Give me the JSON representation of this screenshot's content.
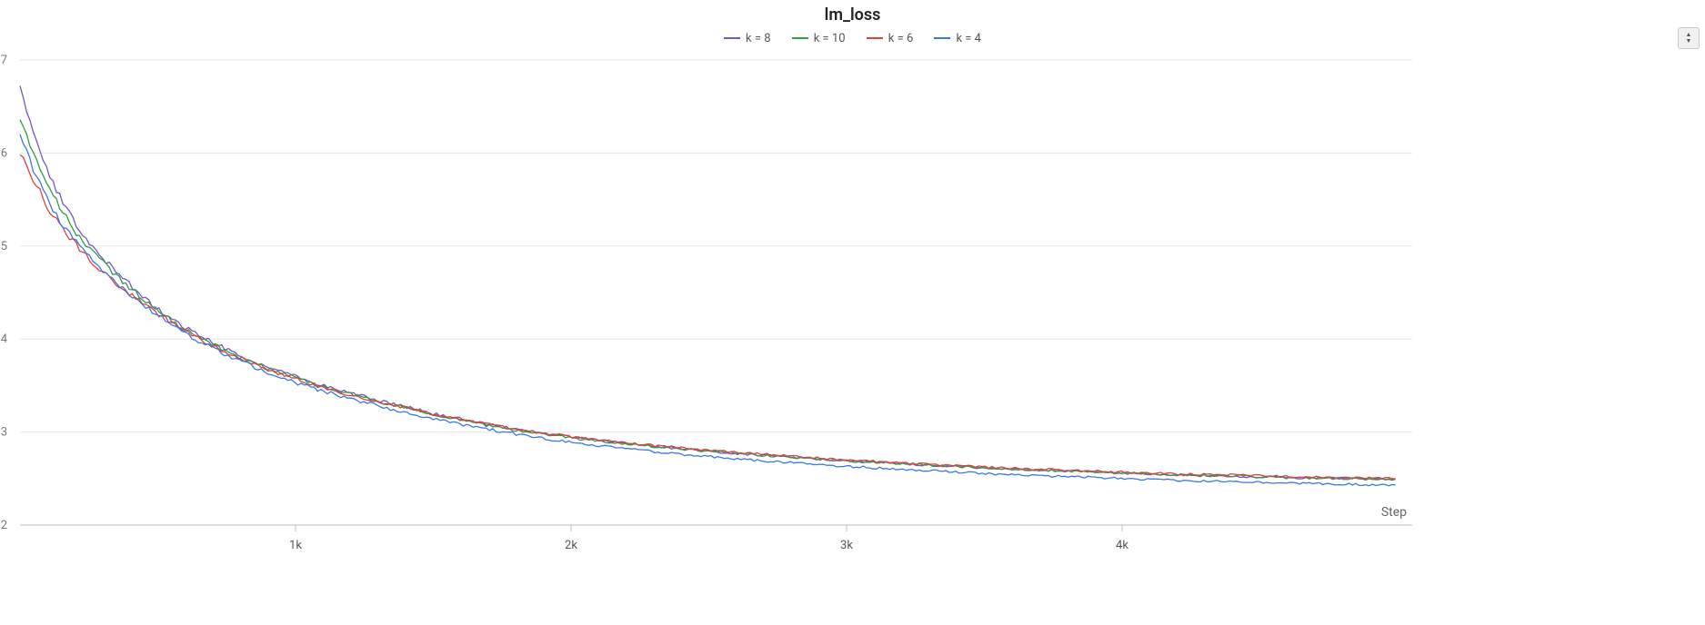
{
  "title": "lm_loss",
  "xlabel": "Step",
  "legend": [
    {
      "name": "k = 8",
      "color": "#7955c7"
    },
    {
      "name": "k = 10",
      "color": "#2e9e48"
    },
    {
      "name": "k = 6",
      "color": "#e2403c"
    },
    {
      "name": "k = 4",
      "color": "#3a78e6"
    }
  ],
  "y_ticks": [
    2,
    3,
    4,
    5,
    6,
    7
  ],
  "x_ticks": [
    {
      "v": 1000,
      "label": "1k"
    },
    {
      "v": 2000,
      "label": "2k"
    },
    {
      "v": 3000,
      "label": "3k"
    },
    {
      "v": 4000,
      "label": "4k"
    }
  ],
  "chart_data": {
    "type": "line",
    "xlabel": "Step",
    "ylabel": "lm_loss",
    "ylim": [
      2,
      7
    ],
    "xlim": [
      0,
      5000
    ],
    "series": [
      {
        "name": "k = 8",
        "color": "#7955c7",
        "x": [
          0,
          50,
          100,
          150,
          200,
          250,
          300,
          350,
          400,
          450,
          500,
          600,
          700,
          800,
          900,
          1000,
          1100,
          1200,
          1300,
          1400,
          1500,
          1600,
          1700,
          1800,
          1900,
          2000,
          2200,
          2400,
          2600,
          2800,
          3000,
          3200,
          3400,
          3600,
          3800,
          4000,
          4200,
          4400,
          4600,
          4800,
          5000
        ],
        "y": [
          6.7,
          6.2,
          5.8,
          5.5,
          5.25,
          5.05,
          4.88,
          4.72,
          4.58,
          4.45,
          4.32,
          4.12,
          3.96,
          3.82,
          3.7,
          3.6,
          3.5,
          3.42,
          3.34,
          3.27,
          3.2,
          3.14,
          3.08,
          3.03,
          2.99,
          2.95,
          2.88,
          2.82,
          2.77,
          2.73,
          2.69,
          2.66,
          2.63,
          2.6,
          2.58,
          2.56,
          2.54,
          2.52,
          2.51,
          2.5,
          2.49
        ]
      },
      {
        "name": "k = 10",
        "color": "#2e9e48",
        "x": [
          0,
          50,
          100,
          150,
          200,
          250,
          300,
          350,
          400,
          450,
          500,
          600,
          700,
          800,
          900,
          1000,
          1100,
          1200,
          1300,
          1400,
          1500,
          1600,
          1700,
          1800,
          1900,
          2000,
          2200,
          2400,
          2600,
          2800,
          3000,
          3200,
          3400,
          3600,
          3800,
          4000,
          4200,
          4400,
          4600,
          4800,
          5000
        ],
        "y": [
          6.4,
          6.0,
          5.65,
          5.38,
          5.16,
          4.98,
          4.82,
          4.68,
          4.55,
          4.42,
          4.3,
          4.1,
          3.94,
          3.8,
          3.68,
          3.58,
          3.49,
          3.41,
          3.33,
          3.26,
          3.19,
          3.13,
          3.07,
          3.02,
          2.98,
          2.94,
          2.87,
          2.82,
          2.77,
          2.73,
          2.69,
          2.66,
          2.63,
          2.6,
          2.58,
          2.56,
          2.54,
          2.53,
          2.51,
          2.5,
          2.49
        ]
      },
      {
        "name": "k = 6",
        "color": "#e2403c",
        "x": [
          0,
          50,
          100,
          150,
          200,
          250,
          300,
          350,
          400,
          450,
          500,
          600,
          700,
          800,
          900,
          1000,
          1100,
          1200,
          1300,
          1400,
          1500,
          1600,
          1700,
          1800,
          1900,
          2000,
          2200,
          2400,
          2600,
          2800,
          3000,
          3200,
          3400,
          3600,
          3800,
          4000,
          4200,
          4400,
          4600,
          4800,
          5000
        ],
        "y": [
          6.0,
          5.7,
          5.42,
          5.2,
          5.02,
          4.86,
          4.72,
          4.6,
          4.48,
          4.37,
          4.27,
          4.08,
          3.93,
          3.79,
          3.67,
          3.57,
          3.48,
          3.4,
          3.33,
          3.26,
          3.19,
          3.13,
          3.08,
          3.03,
          2.99,
          2.95,
          2.88,
          2.83,
          2.78,
          2.74,
          2.7,
          2.67,
          2.64,
          2.61,
          2.59,
          2.57,
          2.55,
          2.54,
          2.52,
          2.51,
          2.5
        ]
      },
      {
        "name": "k = 4",
        "color": "#3a78e6",
        "x": [
          0,
          50,
          100,
          150,
          200,
          250,
          300,
          350,
          400,
          450,
          500,
          600,
          700,
          800,
          900,
          1000,
          1100,
          1200,
          1300,
          1400,
          1500,
          1600,
          1700,
          1800,
          1900,
          2000,
          2200,
          2400,
          2600,
          2800,
          3000,
          3200,
          3400,
          3600,
          3800,
          4000,
          4200,
          4400,
          4600,
          4800,
          5000
        ],
        "y": [
          6.2,
          5.82,
          5.5,
          5.25,
          5.05,
          4.88,
          4.73,
          4.6,
          4.47,
          4.36,
          4.25,
          4.06,
          3.9,
          3.76,
          3.64,
          3.53,
          3.44,
          3.36,
          3.28,
          3.21,
          3.14,
          3.08,
          3.03,
          2.98,
          2.93,
          2.89,
          2.82,
          2.76,
          2.71,
          2.67,
          2.63,
          2.6,
          2.57,
          2.54,
          2.52,
          2.5,
          2.48,
          2.47,
          2.45,
          2.44,
          2.43
        ]
      }
    ]
  }
}
